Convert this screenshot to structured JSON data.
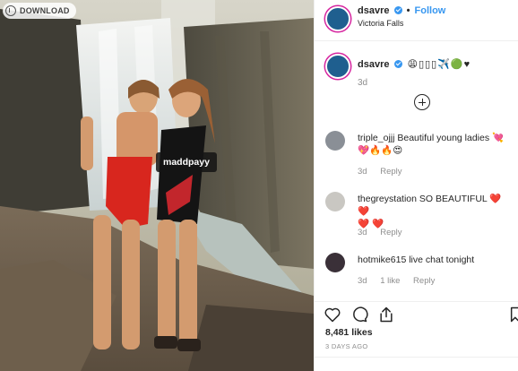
{
  "download": {
    "label": "DOWNLOAD"
  },
  "photo": {
    "tag": "maddpayy"
  },
  "header": {
    "username": "dsavre",
    "separator": "•",
    "follow_label": "Follow",
    "location": "Victoria Falls"
  },
  "caption": {
    "username": "dsavre",
    "emojis": "😩▯▯▯✈️🟢♥",
    "time": "3d"
  },
  "comments": [
    {
      "username": "triple_ojjj",
      "text": "Beautiful young ladies 💘",
      "text2": "💖🔥🔥😍",
      "time": "3d",
      "reply": "Reply",
      "likes": ""
    },
    {
      "username": "thegreystation",
      "text": "SO BEAUTIFUL ❤️ ❤️",
      "text2": "❤️ ❤️",
      "time": "3d",
      "reply": "Reply",
      "likes": ""
    },
    {
      "username": "hotmike615",
      "text": "live chat tonight",
      "text2": "",
      "time": "3d",
      "reply": "Reply",
      "likes": "1 like"
    }
  ],
  "stats": {
    "likes": "8,481 likes",
    "ago": "3 DAYS AGO"
  },
  "colors": {
    "accent": "#3897f0",
    "avatar": "#1f5f8f",
    "heart": "#ed4956"
  },
  "icons": [
    "download-icon",
    "verified-icon",
    "plus-circle-icon",
    "heart-icon",
    "comment-icon",
    "share-icon",
    "bookmark-icon"
  ]
}
